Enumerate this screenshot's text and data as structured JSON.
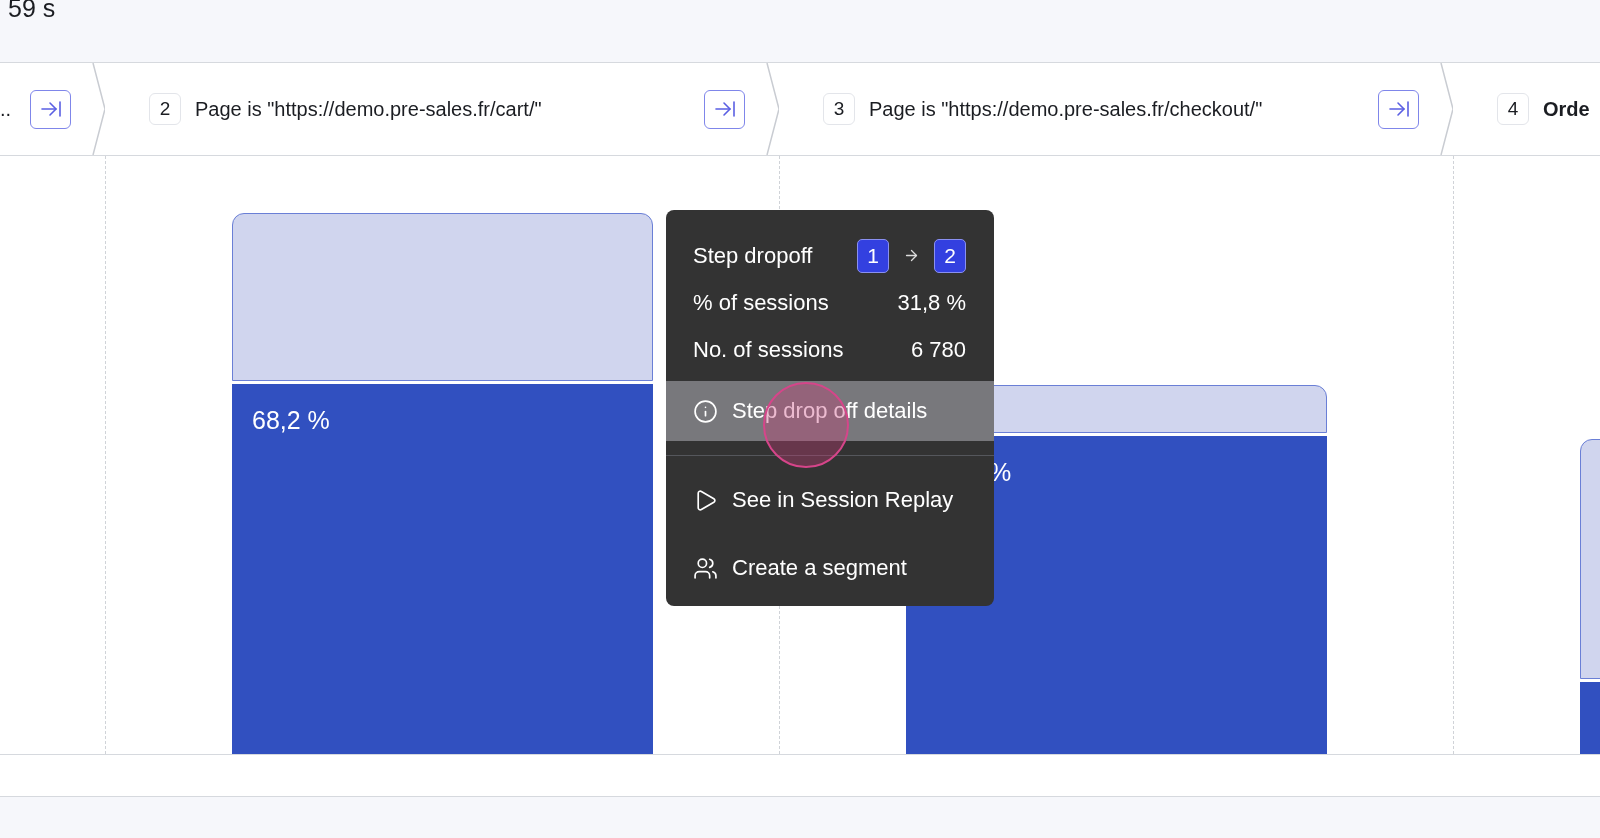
{
  "summary": {
    "value": "59 s"
  },
  "steps": [
    {
      "label": "..",
      "kind": "page"
    },
    {
      "number": "2",
      "label": "Page is \"https://demo.pre-sales.fr/cart/\"",
      "kind": "page"
    },
    {
      "number": "3",
      "label": "Page is \"https://demo.pre-sales.fr/checkout/\"",
      "kind": "page"
    },
    {
      "number": "4",
      "label": "Orde",
      "kind": "event"
    }
  ],
  "bar_labels": [
    "68,2 %",
    "%"
  ],
  "tooltip": {
    "title": "Step dropoff",
    "from": "1",
    "to": "2",
    "rows": [
      {
        "label": "% of sessions",
        "value": "31,8 %"
      },
      {
        "label": "No. of sessions",
        "value": "6 780"
      }
    ],
    "actions": [
      {
        "label": "Step drop off details",
        "kind": "info",
        "selected": true
      },
      {
        "label": "See in Session Replay",
        "kind": "play",
        "selected": false
      },
      {
        "label": "Create a segment",
        "kind": "users",
        "selected": false
      }
    ]
  }
}
